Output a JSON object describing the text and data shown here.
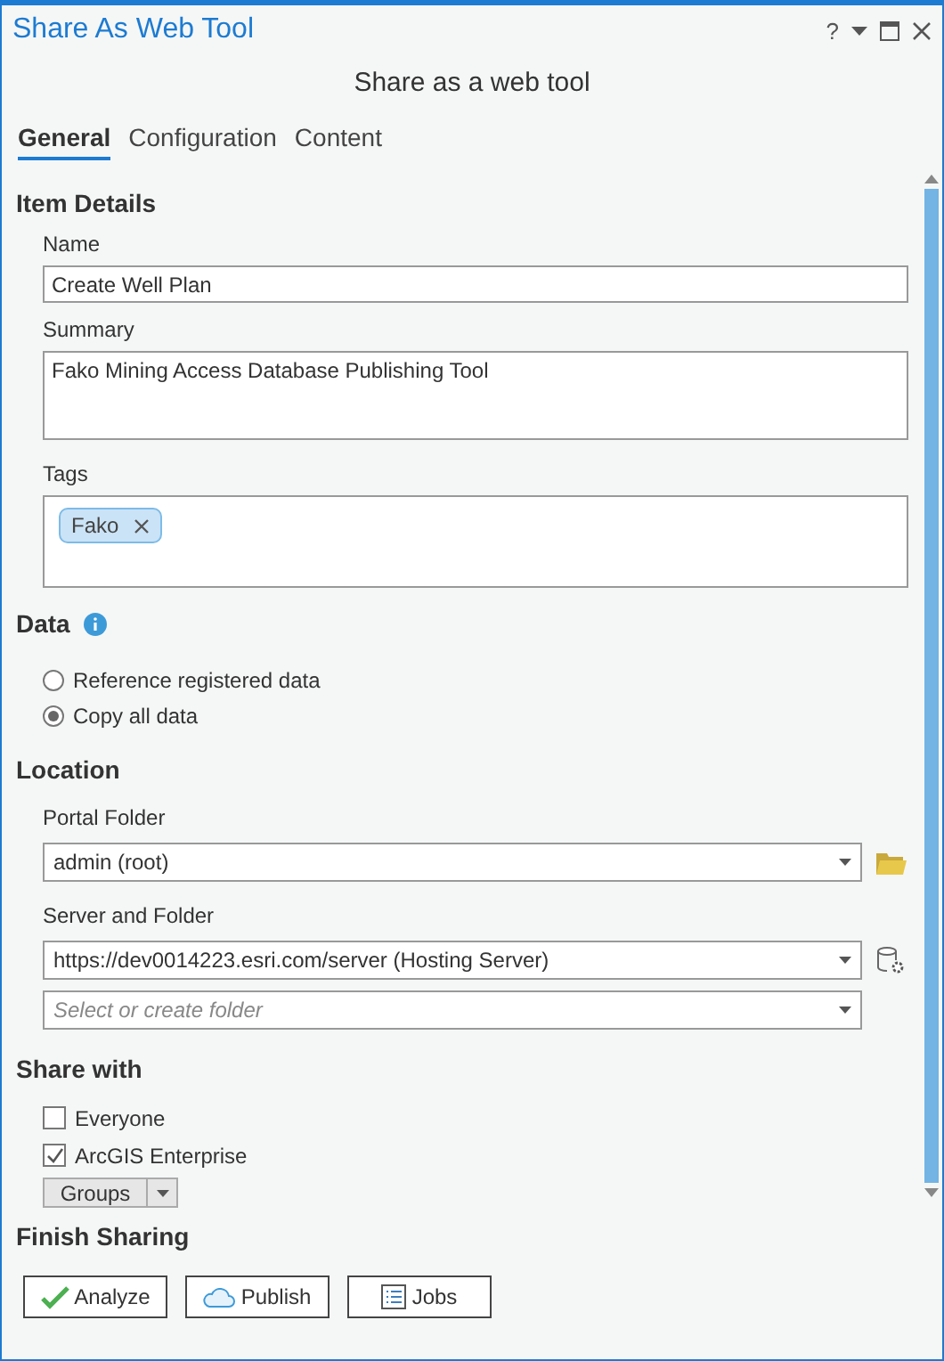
{
  "window": {
    "title": "Share As Web Tool",
    "help": "?"
  },
  "heading": "Share as a web tool",
  "tabs": [
    {
      "label": "General",
      "selected": true
    },
    {
      "label": "Configuration",
      "selected": false
    },
    {
      "label": "Content",
      "selected": false
    }
  ],
  "item_details": {
    "title": "Item Details",
    "name_label": "Name",
    "name": "Create Well Plan",
    "summary_label": "Summary",
    "summary": "Fako Mining Access Database Publishing Tool",
    "tags_label": "Tags",
    "tags": [
      "Fako"
    ]
  },
  "data": {
    "title": "Data",
    "options": [
      {
        "label": "Reference registered data",
        "selected": false
      },
      {
        "label": "Copy all data",
        "selected": true
      }
    ]
  },
  "location": {
    "title": "Location",
    "portal_label": "Portal Folder",
    "portal_folder": "admin (root)",
    "server_label": "Server and Folder",
    "server": "https://dev0014223.esri.com/server (Hosting Server)",
    "folder_placeholder": "Select or create folder"
  },
  "share_with": {
    "title": "Share with",
    "options": [
      {
        "label": "Everyone",
        "checked": false
      },
      {
        "label": "ArcGIS Enterprise",
        "checked": true
      }
    ],
    "groups_button": "Groups"
  },
  "finish": {
    "title": "Finish Sharing",
    "buttons": [
      {
        "label": "Analyze",
        "kind": "analyze"
      },
      {
        "label": "Publish",
        "kind": "publish"
      },
      {
        "label": "Jobs",
        "kind": "jobs"
      }
    ]
  }
}
